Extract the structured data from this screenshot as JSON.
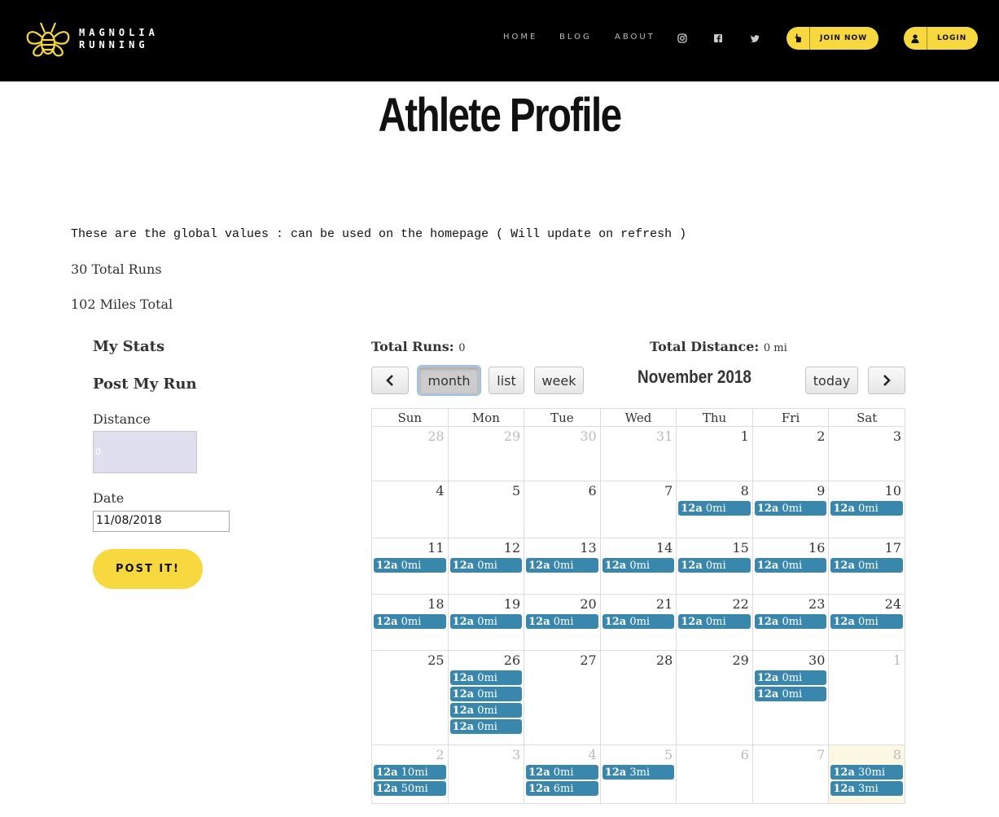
{
  "header": {
    "brand_line1": "MAGNOLIA",
    "brand_line2": "RUNNING",
    "nav": [
      "HOME",
      "BLOG",
      "ABOUT"
    ],
    "social": [
      "instagram-icon",
      "facebook-icon",
      "twitter-icon"
    ],
    "join_label": "JOIN NOW",
    "login_label": "LOGIN",
    "accent_color": "#f7d93f"
  },
  "page": {
    "title": "Athlete Profile",
    "global_note": "These are the global values : can be used on the homepage ( Will update on refresh )",
    "total_runs": "30 Total Runs",
    "miles_total": "102 Miles Total"
  },
  "sidebar": {
    "my_stats": "My Stats",
    "post_my_run": "Post My Run",
    "distance_label": "Distance",
    "distance_value": "0",
    "date_label": "Date",
    "date_value": "11/08/2018",
    "post_button": "POST IT!"
  },
  "calendar": {
    "total_runs_label": "Total Runs:",
    "total_runs_value": "0",
    "total_distance_label": "Total Distance:",
    "total_distance_value": "0 mi",
    "view_buttons": [
      "month",
      "list",
      "week"
    ],
    "active_view": "month",
    "today_label": "today",
    "title": "November 2018",
    "weekdays": [
      "Sun",
      "Mon",
      "Tue",
      "Wed",
      "Thu",
      "Fri",
      "Sat"
    ],
    "event_color": "#3a87ad",
    "weeks": [
      [
        {
          "d": "28",
          "o": true,
          "ev": []
        },
        {
          "d": "29",
          "o": true,
          "ev": []
        },
        {
          "d": "30",
          "o": true,
          "ev": []
        },
        {
          "d": "31",
          "o": true,
          "ev": []
        },
        {
          "d": "1",
          "ev": []
        },
        {
          "d": "2",
          "ev": []
        },
        {
          "d": "3",
          "ev": []
        }
      ],
      [
        {
          "d": "4",
          "ev": []
        },
        {
          "d": "5",
          "ev": []
        },
        {
          "d": "6",
          "ev": []
        },
        {
          "d": "7",
          "ev": []
        },
        {
          "d": "8",
          "ev": [
            "0mi"
          ]
        },
        {
          "d": "9",
          "ev": [
            "0mi"
          ]
        },
        {
          "d": "10",
          "ev": [
            "0mi"
          ]
        }
      ],
      [
        {
          "d": "11",
          "ev": [
            "0mi"
          ]
        },
        {
          "d": "12",
          "ev": [
            "0mi"
          ]
        },
        {
          "d": "13",
          "ev": [
            "0mi"
          ]
        },
        {
          "d": "14",
          "ev": [
            "0mi"
          ]
        },
        {
          "d": "15",
          "ev": [
            "0mi"
          ]
        },
        {
          "d": "16",
          "ev": [
            "0mi"
          ]
        },
        {
          "d": "17",
          "ev": [
            "0mi"
          ]
        }
      ],
      [
        {
          "d": "18",
          "ev": [
            "0mi"
          ]
        },
        {
          "d": "19",
          "ev": [
            "0mi"
          ]
        },
        {
          "d": "20",
          "ev": [
            "0mi"
          ]
        },
        {
          "d": "21",
          "ev": [
            "0mi"
          ]
        },
        {
          "d": "22",
          "ev": [
            "0mi"
          ]
        },
        {
          "d": "23",
          "ev": [
            "0mi"
          ]
        },
        {
          "d": "24",
          "ev": [
            "0mi"
          ]
        }
      ],
      [
        {
          "d": "25",
          "ev": []
        },
        {
          "d": "26",
          "ev": [
            "0mi",
            "0mi",
            "0mi",
            "0mi"
          ]
        },
        {
          "d": "27",
          "ev": []
        },
        {
          "d": "28",
          "ev": []
        },
        {
          "d": "29",
          "ev": []
        },
        {
          "d": "30",
          "ev": [
            "0mi",
            "0mi"
          ]
        },
        {
          "d": "1",
          "o": true,
          "ev": []
        }
      ],
      [
        {
          "d": "2",
          "o": true,
          "ev": [
            "10mi",
            "50mi"
          ]
        },
        {
          "d": "3",
          "o": true,
          "ev": []
        },
        {
          "d": "4",
          "o": true,
          "ev": [
            "0mi",
            "6mi"
          ]
        },
        {
          "d": "5",
          "o": true,
          "ev": [
            "3mi"
          ]
        },
        {
          "d": "6",
          "o": true,
          "ev": []
        },
        {
          "d": "7",
          "o": true,
          "ev": []
        },
        {
          "d": "8",
          "o": true,
          "today": true,
          "ev": [
            "30mi",
            "3mi"
          ]
        }
      ]
    ],
    "event_time": "12a"
  }
}
